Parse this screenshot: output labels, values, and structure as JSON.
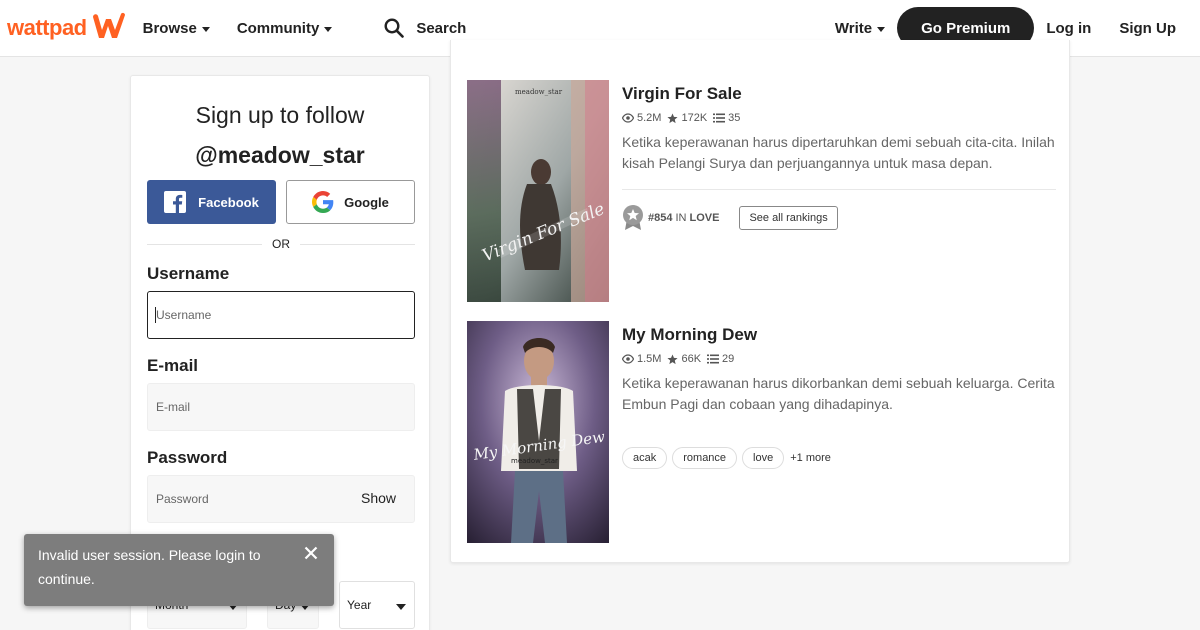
{
  "header": {
    "logo_text": "wattpad",
    "browse": "Browse",
    "community": "Community",
    "search_placeholder": "Search",
    "write": "Write",
    "premium": "Go Premium",
    "login": "Log in",
    "signup": "Sign Up",
    "brand_color": "#ff6122"
  },
  "signup_card": {
    "title": "Sign up to follow",
    "username_handle": "@meadow_star",
    "facebook": "Facebook",
    "google": "Google",
    "or": "OR",
    "username_label": "Username",
    "username_placeholder": "Username",
    "email_label": "E-mail",
    "email_placeholder": "E-mail",
    "password_label": "Password",
    "password_placeholder": "Password",
    "show": "Show",
    "month": "Month",
    "day": "Day",
    "year": "Year"
  },
  "toast": {
    "message": "Invalid user session. Please login to continue."
  },
  "stories": [
    {
      "title": "Virgin For Sale",
      "reads": "5.2M",
      "votes": "172K",
      "parts": "35",
      "description": "Ketika keperawanan harus dipertaruhkan demi sebuah cita-cita. Inilah kisah Pelangi Surya dan perjuangannya untuk masa depan.",
      "cover_author": "meadow_star",
      "cover_title": "Virgin For Sale",
      "rank_number": "#854",
      "rank_in": "IN",
      "rank_category": "LOVE",
      "all_rankings": "See all rankings"
    },
    {
      "title": "My Morning Dew",
      "reads": "1.5M",
      "votes": "66K",
      "parts": "29",
      "description": "Ketika keperawanan harus dikorbankan demi sebuah keluarga. Cerita Embun Pagi dan cobaan yang dihadapinya.",
      "cover_author": "meadow_star",
      "cover_title": "My Morning Dew",
      "tags": [
        "acak",
        "romance",
        "love"
      ],
      "more_tags": "+1 more"
    }
  ]
}
